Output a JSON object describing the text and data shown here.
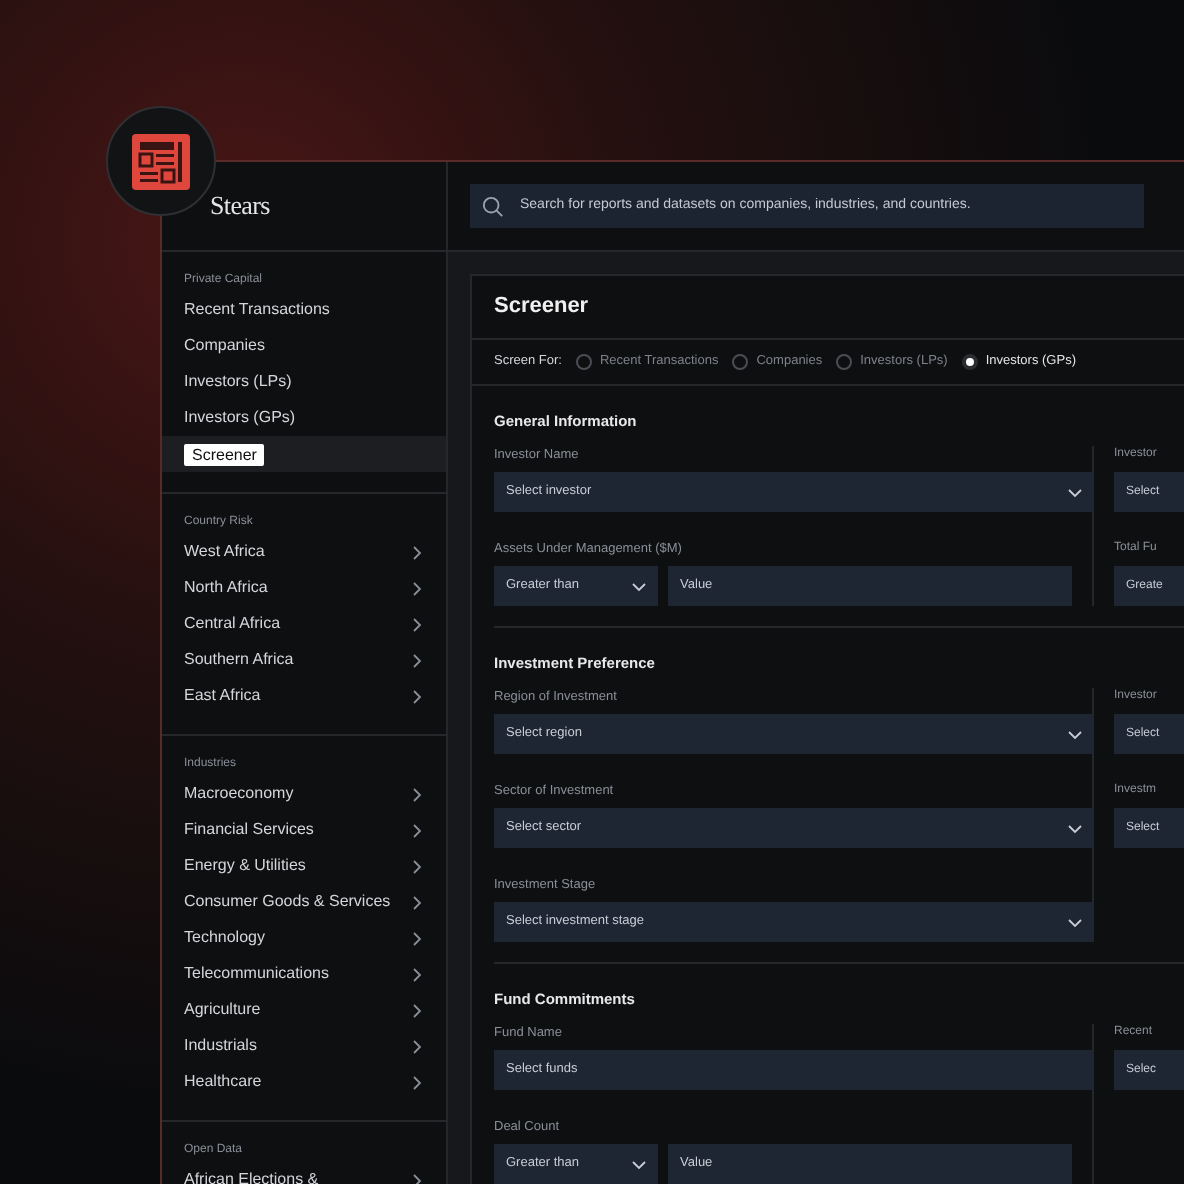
{
  "brand": {
    "name": "Stears"
  },
  "search": {
    "placeholder": "Search for reports and datasets on companies, industries, and countries."
  },
  "sidebar": {
    "sections": [
      {
        "title": "Private Capital",
        "items": [
          {
            "label": "Recent Transactions",
            "selected": false,
            "has_submenu": false
          },
          {
            "label": "Companies",
            "selected": false,
            "has_submenu": false
          },
          {
            "label": "Investors (LPs)",
            "selected": false,
            "has_submenu": false
          },
          {
            "label": "Investors (GPs)",
            "selected": false,
            "has_submenu": false
          },
          {
            "label": "Screener",
            "selected": true,
            "has_submenu": false
          }
        ]
      },
      {
        "title": "Country Risk",
        "items": [
          {
            "label": "West Africa",
            "selected": false,
            "has_submenu": true
          },
          {
            "label": "North Africa",
            "selected": false,
            "has_submenu": true
          },
          {
            "label": "Central Africa",
            "selected": false,
            "has_submenu": true
          },
          {
            "label": "Southern Africa",
            "selected": false,
            "has_submenu": true
          },
          {
            "label": "East Africa",
            "selected": false,
            "has_submenu": true
          }
        ]
      },
      {
        "title": "Industries",
        "items": [
          {
            "label": "Macroeconomy",
            "selected": false,
            "has_submenu": true
          },
          {
            "label": "Financial Services",
            "selected": false,
            "has_submenu": true
          },
          {
            "label": "Energy & Utilities",
            "selected": false,
            "has_submenu": true
          },
          {
            "label": "Consumer Goods & Services",
            "selected": false,
            "has_submenu": true
          },
          {
            "label": "Technology",
            "selected": false,
            "has_submenu": true
          },
          {
            "label": "Telecommunications",
            "selected": false,
            "has_submenu": true
          },
          {
            "label": "Agriculture",
            "selected": false,
            "has_submenu": true
          },
          {
            "label": "Industrials",
            "selected": false,
            "has_submenu": true
          },
          {
            "label": "Healthcare",
            "selected": false,
            "has_submenu": true
          }
        ]
      },
      {
        "title": "Open Data",
        "items": [
          {
            "label": "African Elections &",
            "selected": false,
            "has_submenu": true
          }
        ]
      }
    ]
  },
  "screener": {
    "title": "Screener",
    "screen_for_label": "Screen For:",
    "options": [
      {
        "label": "Recent Transactions",
        "selected": false
      },
      {
        "label": "Companies",
        "selected": false
      },
      {
        "label": "Investors (LPs)",
        "selected": false
      },
      {
        "label": "Investors (GPs)",
        "selected": true
      }
    ],
    "sections": [
      {
        "title": "General Information",
        "left_fields": [
          {
            "kind": "select",
            "label": "Investor Name",
            "placeholder": "Select investor"
          },
          {
            "kind": "range",
            "label": "Assets Under Management ($M)",
            "operator": "Greater than",
            "placeholder": "Value"
          }
        ],
        "right_fields": [
          {
            "label": "Investor",
            "value": "Select"
          },
          {
            "label": "Total Fu",
            "value": "Greate"
          }
        ]
      },
      {
        "title": "Investment Preference",
        "left_fields": [
          {
            "kind": "select",
            "label": "Region of Investment",
            "placeholder": "Select region"
          },
          {
            "kind": "select",
            "label": "Sector of Investment",
            "placeholder": "Select sector"
          },
          {
            "kind": "select",
            "label": "Investment Stage",
            "placeholder": "Select investment stage"
          }
        ],
        "right_fields": [
          {
            "label": "Investor",
            "value": "Select"
          },
          {
            "label": "Investm",
            "value": "Select"
          }
        ]
      },
      {
        "title": "Fund Commitments",
        "left_fields": [
          {
            "kind": "input",
            "label": "Fund Name",
            "placeholder": "Select funds"
          },
          {
            "kind": "range",
            "label": "Deal Count",
            "operator": "Greater than",
            "placeholder": "Value"
          }
        ],
        "right_fields": [
          {
            "label": "Recent",
            "value": "Selec"
          }
        ]
      }
    ]
  }
}
